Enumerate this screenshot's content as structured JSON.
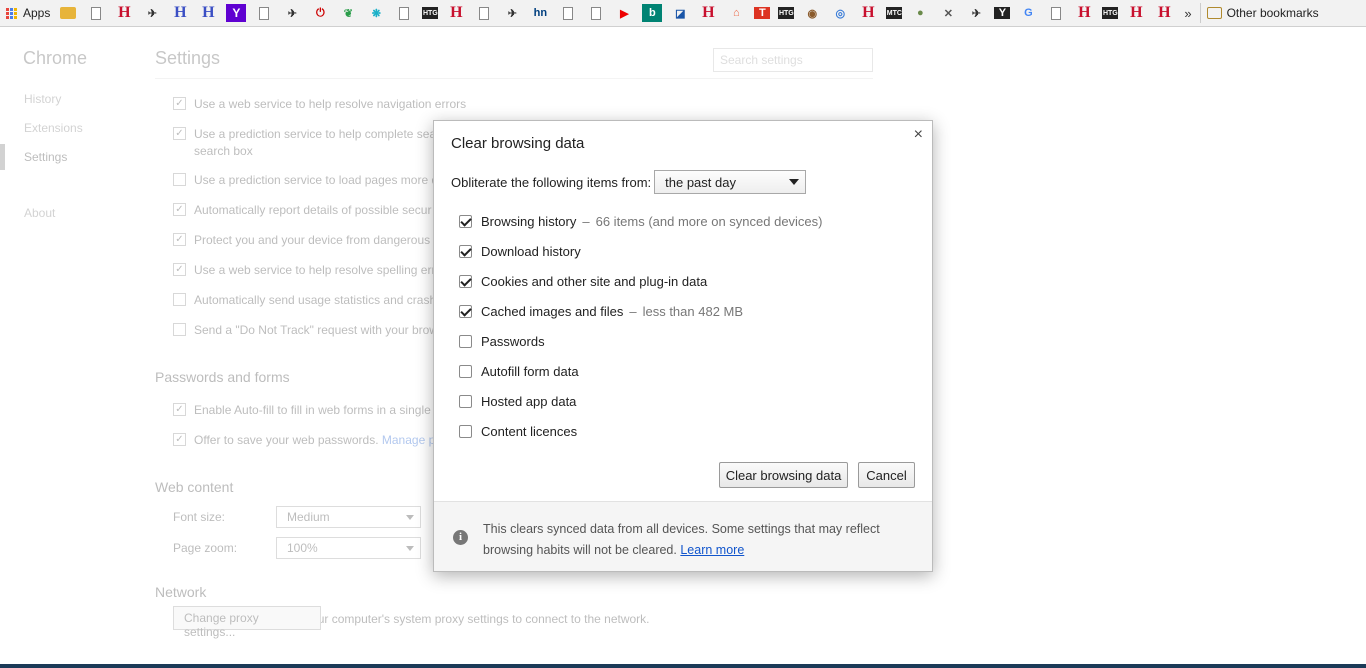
{
  "bookmarks_bar": {
    "apps_label": "Apps",
    "other_bookmarks": "Other bookmarks",
    "icons": [
      "folder-icon",
      "page-icon",
      "H-red",
      "bird-icon",
      "H-blue",
      "H-blue",
      "Y-purple",
      "page-icon",
      "bird-icon",
      "power-icon",
      "leaf-icon",
      "butterfly-icon",
      "page-icon",
      "HTG",
      "H-red",
      "page-icon",
      "bird-icon",
      "hn-icon",
      "page-icon",
      "page-icon",
      "youtube-icon",
      "bing-icon",
      "chart-icon",
      "H-red",
      "home-icon",
      "T-icon",
      "HTG",
      "clock-icon",
      "globe-icon",
      "H-red",
      "MTC",
      "seal-icon",
      "sword-icon",
      "bird-icon",
      "Y-dark",
      "google-icon",
      "page-icon",
      "H-red",
      "HTG",
      "H-red",
      "H-red"
    ]
  },
  "settings_nav": {
    "title": "Chrome",
    "items": [
      "History",
      "Extensions",
      "Settings",
      "About"
    ]
  },
  "settings_page": {
    "title": "Settings",
    "search_placeholder": "Search settings",
    "privacy_rows": [
      {
        "checked": true,
        "text": "Use a web service to help resolve navigation errors"
      },
      {
        "checked": true,
        "text": "Use a prediction service to help complete sea"
      },
      {
        "checked": false,
        "text": "Use a prediction service to load pages more q"
      },
      {
        "checked": true,
        "text": "Automatically report details of possible secur"
      },
      {
        "checked": true,
        "text": "Protect you and your device from dangerous"
      },
      {
        "checked": true,
        "text": "Use a web service to help resolve spelling err"
      },
      {
        "checked": false,
        "text": "Automatically send usage statistics and crash"
      },
      {
        "checked": false,
        "text": "Send a \"Do Not Track\" request with your brow"
      }
    ],
    "search_box_cont": "search box",
    "passwords_title": "Passwords and forms",
    "autofill_text": "Enable Auto-fill to fill in web forms in a single",
    "save_pw_text": "Offer to save your web passwords.",
    "manage_link": "Manage p",
    "web_content_title": "Web content",
    "font_size_label": "Font size:",
    "font_size_value": "Medium",
    "page_zoom_label": "Page zoom:",
    "page_zoom_value": "100%",
    "network_title": "Network",
    "network_text": "Google Chrome is using your computer's system proxy settings to connect to the network.",
    "proxy_button": "Change proxy settings..."
  },
  "dialog": {
    "title": "Clear browsing data",
    "close_glyph": "×",
    "period_label": "Obliterate the following items from:",
    "period_value": "the past day",
    "items": [
      {
        "label": "Browsing history",
        "checked": true,
        "detail": "66 items (and more on synced devices)"
      },
      {
        "label": "Download history",
        "checked": true,
        "detail": ""
      },
      {
        "label": "Cookies and other site and plug-in data",
        "checked": true,
        "detail": ""
      },
      {
        "label": "Cached images and files",
        "checked": true,
        "detail": "less than 482 MB"
      },
      {
        "label": "Passwords",
        "checked": false,
        "detail": ""
      },
      {
        "label": "Autofill form data",
        "checked": false,
        "detail": ""
      },
      {
        "label": "Hosted app data",
        "checked": false,
        "detail": ""
      },
      {
        "label": "Content licences",
        "checked": false,
        "detail": ""
      }
    ],
    "detail_separator": "–",
    "clear_button": "Clear browsing data",
    "cancel_button": "Cancel",
    "footer_text": "This clears synced data from all devices. Some settings that may reflect browsing habits will not be cleared.",
    "learn_more": "Learn more"
  }
}
